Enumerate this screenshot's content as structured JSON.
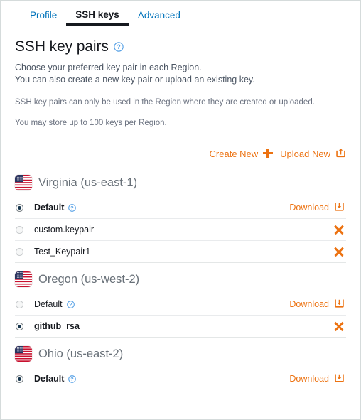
{
  "tabs": [
    {
      "label": "Profile",
      "active": false
    },
    {
      "label": "SSH keys",
      "active": true
    },
    {
      "label": "Advanced",
      "active": false
    }
  ],
  "header": {
    "title": "SSH key pairs",
    "help_icon": "help-circle-icon",
    "lead_line1": "Choose your preferred key pair in each Region.",
    "lead_line2": "You can also create a new key pair or upload an existing key.",
    "note1": "SSH key pairs can only be used in the Region where they are created or uploaded.",
    "note2": "You may store up to 100 keys per Region."
  },
  "actions": {
    "create_label": "Create New",
    "create_icon": "plus-icon",
    "upload_label": "Upload New",
    "upload_icon": "upload-icon"
  },
  "labels": {
    "download": "Download",
    "download_icon": "download-icon",
    "delete_icon": "close-x-icon",
    "flag_icon": "us-flag-icon"
  },
  "colors": {
    "accent_orange": "#ec7211",
    "link_blue": "#0073bb",
    "text_dark": "#16191f",
    "region_gray": "#687078",
    "radio_selected": "#16354d"
  },
  "regions": [
    {
      "name": "Virginia (us-east-1)",
      "keys": [
        {
          "label": "Default",
          "selected": true,
          "has_help": true,
          "action": "download"
        },
        {
          "label": "custom.keypair",
          "selected": false,
          "has_help": false,
          "action": "delete"
        },
        {
          "label": "Test_Keypair1",
          "selected": false,
          "has_help": false,
          "action": "delete"
        }
      ]
    },
    {
      "name": "Oregon (us-west-2)",
      "keys": [
        {
          "label": "Default",
          "selected": false,
          "has_help": true,
          "action": "download"
        },
        {
          "label": "github_rsa",
          "selected": true,
          "has_help": false,
          "action": "delete"
        }
      ]
    },
    {
      "name": "Ohio (us-east-2)",
      "keys": [
        {
          "label": "Default",
          "selected": true,
          "has_help": true,
          "action": "download"
        }
      ]
    }
  ]
}
